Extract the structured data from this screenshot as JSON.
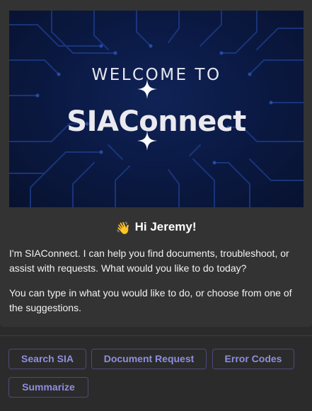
{
  "hero": {
    "welcome_text": "WELCOME TO",
    "brand_text": "SIAConnect"
  },
  "greeting": {
    "emoji": "👋",
    "text": "Hi Jeremy!"
  },
  "messages": [
    "I'm SIAConnect. I can help you find documents, troubleshoot, or assist with requests. What would you like to do today?",
    "You can type in what you would like to do, or choose from one of the suggestions."
  ],
  "suggestions": [
    {
      "label": "Search SIA"
    },
    {
      "label": "Document Request"
    },
    {
      "label": "Error Codes"
    },
    {
      "label": "Summarize"
    }
  ],
  "colors": {
    "chip_text": "#8f8ee0",
    "chip_border": "#4e4a7d",
    "hero_bg": "#0b1a45",
    "card_bg": "#333333",
    "page_bg": "#2b2b2b"
  }
}
